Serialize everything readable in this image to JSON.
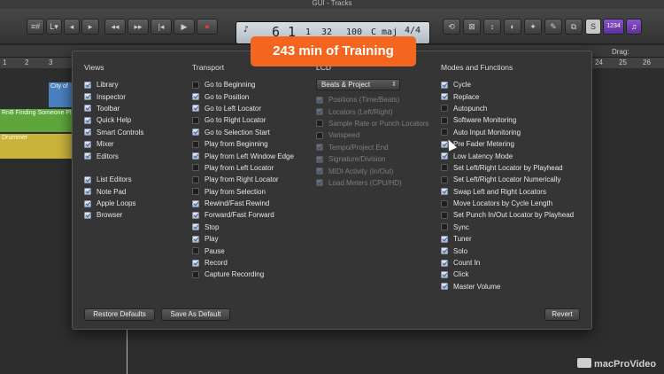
{
  "window": {
    "title": "GUI - Tracks"
  },
  "toolbar": {
    "left_buttons": [
      "≡#",
      "L▾",
      "◂",
      "▸",
      "▶"
    ],
    "transport": [
      "◂◂",
      "▸▸",
      "|◂",
      "▶",
      "●"
    ],
    "lcd": {
      "bar": "6",
      "beat": "1",
      "div": "1",
      "tick": "32",
      "tempo": "100",
      "key": "C maj",
      "signature": "4/4"
    },
    "right_buttons": [
      "⟲",
      "⊠",
      "↕",
      "◐",
      "✦",
      "✎",
      "⧉",
      "S",
      "1234",
      "♫"
    ]
  },
  "banner": {
    "text": "243 min of Training"
  },
  "workarea": {
    "drag_label": "Drag:",
    "ruler": [
      "1",
      "2",
      "3",
      "24",
      "25",
      "26"
    ],
    "regions": [
      {
        "label": "City of",
        "color": "#4a7fc1"
      },
      {
        "label": "RnB Finding Someone Pla",
        "color": "#5ea63c"
      },
      {
        "label": "Drummer",
        "color": "#c9b33a"
      }
    ]
  },
  "dialog": {
    "views": {
      "heading": "Views",
      "items": [
        {
          "label": "Library",
          "checked": true
        },
        {
          "label": "Inspector",
          "checked": true
        },
        {
          "label": "Toolbar",
          "checked": true
        },
        {
          "label": "Quick Help",
          "checked": true
        },
        {
          "label": "Smart Controls",
          "checked": true
        },
        {
          "label": "Mixer",
          "checked": true
        },
        {
          "label": "Editors",
          "checked": true
        },
        {
          "label": "",
          "gap": true
        },
        {
          "label": "List Editors",
          "checked": true
        },
        {
          "label": "Note Pad",
          "checked": true
        },
        {
          "label": "Apple Loops",
          "checked": true
        },
        {
          "label": "Browser",
          "checked": true
        }
      ]
    },
    "transport": {
      "heading": "Transport",
      "items": [
        {
          "label": "Go to Beginning",
          "checked": false
        },
        {
          "label": "Go to Position",
          "checked": true
        },
        {
          "label": "Go to Left Locator",
          "checked": true
        },
        {
          "label": "Go to Right Locator",
          "checked": false
        },
        {
          "label": "Go to Selection Start",
          "checked": true
        },
        {
          "label": "Play from Beginning",
          "checked": false
        },
        {
          "label": "Play from Left Window Edge",
          "checked": true
        },
        {
          "label": "Play from Left Locator",
          "checked": false
        },
        {
          "label": "Play from Right Locator",
          "checked": false
        },
        {
          "label": "Play from Selection",
          "checked": false
        },
        {
          "label": "Rewind/Fast Rewind",
          "checked": true
        },
        {
          "label": "Forward/Fast Forward",
          "checked": true
        },
        {
          "label": "Stop",
          "checked": true
        },
        {
          "label": "Play",
          "checked": true
        },
        {
          "label": "Pause",
          "checked": false
        },
        {
          "label": "Record",
          "checked": true
        },
        {
          "label": "Capture Recording",
          "checked": false
        }
      ]
    },
    "lcd": {
      "heading": "LCD",
      "mode": "Beats & Project",
      "items": [
        {
          "label": "Positions (Time/Beats)",
          "checked": true
        },
        {
          "label": "Locators (Left/Right)",
          "checked": true
        },
        {
          "label": "Sample Rate or Punch Locators",
          "checked": false
        },
        {
          "label": "Varispeed",
          "checked": false
        },
        {
          "label": "Tempo/Project End",
          "checked": true
        },
        {
          "label": "Signature/Division",
          "checked": true
        },
        {
          "label": "MIDI Activity (In/Out)",
          "checked": true
        },
        {
          "label": "Load Meters (CPU/HD)",
          "checked": true
        }
      ]
    },
    "modes": {
      "heading": "Modes and Functions",
      "items": [
        {
          "label": "Cycle",
          "checked": true
        },
        {
          "label": "Replace",
          "checked": true
        },
        {
          "label": "Autopunch",
          "checked": false
        },
        {
          "label": "Software Monitoring",
          "checked": false
        },
        {
          "label": "Auto Input Monitoring",
          "checked": false
        },
        {
          "label": "Pre Fader Metering",
          "checked": true
        },
        {
          "label": "Low Latency Mode",
          "checked": true
        },
        {
          "label": "Set Left/Right Locator by Playhead",
          "checked": false
        },
        {
          "label": "Set Left/Right Locator Numerically",
          "checked": false
        },
        {
          "label": "Swap Left and Right Locators",
          "checked": true
        },
        {
          "label": "Move Locators by Cycle Length",
          "checked": false
        },
        {
          "label": "Set Punch In/Out Locator by Playhead",
          "checked": false
        },
        {
          "label": "Sync",
          "checked": false
        },
        {
          "label": "Tuner",
          "checked": true
        },
        {
          "label": "Solo",
          "checked": true
        },
        {
          "label": "Count In",
          "checked": true
        },
        {
          "label": "Click",
          "checked": true
        },
        {
          "label": "Master Volume",
          "checked": true
        }
      ]
    },
    "buttons": {
      "restore": "Restore Defaults",
      "save": "Save As Default",
      "revert": "Revert"
    }
  },
  "watermark": {
    "text": "macProVideo"
  }
}
